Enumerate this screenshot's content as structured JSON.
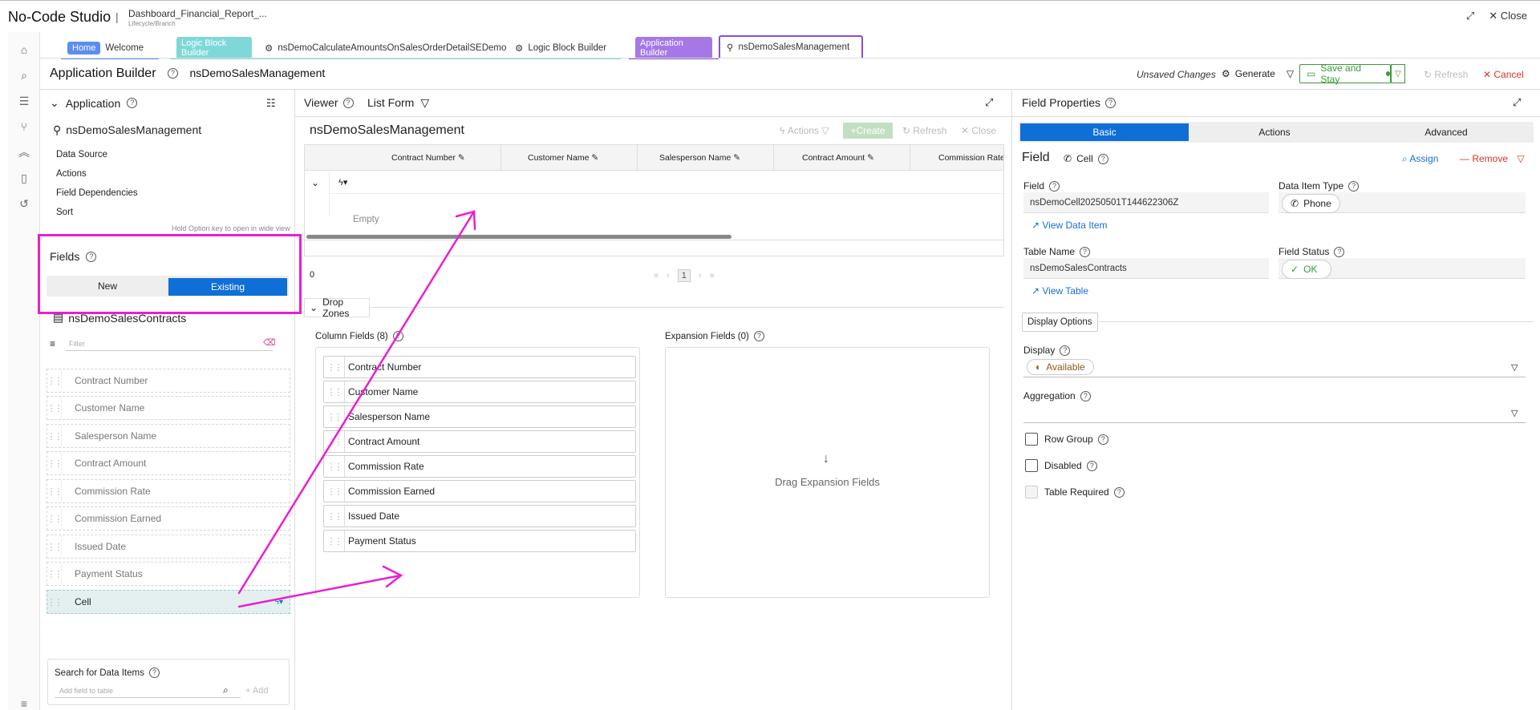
{
  "app": {
    "title": "No-Code Studio",
    "separator": "|",
    "project_name": "Dashboard_Financial_Report_...",
    "project_sub": "Lifecycle/Branch",
    "expand_icon": "expand-icon",
    "close_label": "Close"
  },
  "tabs": [
    {
      "badge": "Home",
      "badge_color": "#5b8def",
      "label": "Welcome",
      "line_color": "#5b8def"
    },
    {
      "badge": "Logic Block Builder",
      "badge_color": "#7fd8d8",
      "label": "",
      "line_color": "#7fd8d8"
    },
    {
      "badge": "",
      "label": "nsDemoCalculateAmountsOnSalesOrderDetailSEDemo",
      "line_color": "#7fd8d8"
    },
    {
      "badge": "",
      "label": "Logic Block Builder",
      "line_color": "#7fd8d8"
    },
    {
      "badge": "Application Builder",
      "badge_color": "#a678e6",
      "label": "",
      "line_color": "#8a4fd6"
    },
    {
      "badge": "",
      "label": "nsDemoSalesManagement",
      "line_color": "#8a4fd6"
    }
  ],
  "header": {
    "title": "Application Builder",
    "subtitle": "nsDemoSalesManagement",
    "unsaved": "Unsaved Changes",
    "generate": "Generate",
    "save": "Save and Stay",
    "refresh": "Refresh",
    "cancel": "Cancel"
  },
  "left": {
    "section": "Application",
    "app_name": "nsDemoSalesManagement",
    "menu": [
      "Data Source",
      "Actions",
      "Field Dependencies",
      "Sort"
    ],
    "hint": "Hold Option key to open in wide view",
    "fields_title": "Fields",
    "seg_new": "New",
    "seg_existing": "Existing",
    "table_name": "nsDemoSalesContracts",
    "filter_placeholder": "Filter",
    "fields": [
      "Contract Number",
      "Customer Name",
      "Salesperson Name",
      "Contract Amount",
      "Commission Rate",
      "Commission Earned",
      "Issued Date",
      "Payment Status",
      "Cell"
    ],
    "search_title": "Search for Data Items",
    "search_placeholder": "Add field to table",
    "add": "Add"
  },
  "viewer": {
    "title": "Viewer",
    "form": "List Form",
    "app_name": "nsDemoSalesManagement",
    "actions": "Actions",
    "create": "Create",
    "refresh": "Refresh",
    "close": "Close",
    "columns": [
      "Contract Number",
      "Customer Name",
      "Salesperson Name",
      "Contract Amount",
      "Commission Rate"
    ],
    "empty": "Empty",
    "count": "0",
    "page": "1",
    "drop_zones": "Drop Zones",
    "column_fields_title": "Column Fields (8)",
    "expansion_title": "Expansion Fields (0)",
    "column_fields": [
      "Contract Number",
      "Customer Name",
      "Salesperson Name",
      "Contract Amount",
      "Commission Rate",
      "Commission Earned",
      "Issued Date",
      "Payment Status"
    ],
    "drag_expansion": "Drag Expansion Fields"
  },
  "props": {
    "title": "Field Properties",
    "tab_basic": "Basic",
    "tab_actions": "Actions",
    "tab_advanced": "Advanced",
    "heading": "Field",
    "heading_type": "Cell",
    "assign": "Assign",
    "remove": "Remove",
    "field_label": "Field",
    "field_value": "nsDemoCell20250501T144622306Z",
    "data_item_type_label": "Data Item Type",
    "data_item_type": "Phone",
    "view_data_item": "View Data Item",
    "table_name_label": "Table Name",
    "table_name": "nsDemoSalesContracts",
    "field_status_label": "Field Status",
    "field_status": "OK",
    "view_table": "View Table",
    "display_options": "Display Options",
    "display_label": "Display",
    "display_value": "Available",
    "aggregation_label": "Aggregation",
    "row_group": "Row Group",
    "disabled": "Disabled",
    "table_required": "Table Required"
  },
  "colors": {
    "primary": "#0f6fd6",
    "highlight": "#ea1fd2",
    "success": "#3a9a3a",
    "danger": "#d9342b"
  }
}
